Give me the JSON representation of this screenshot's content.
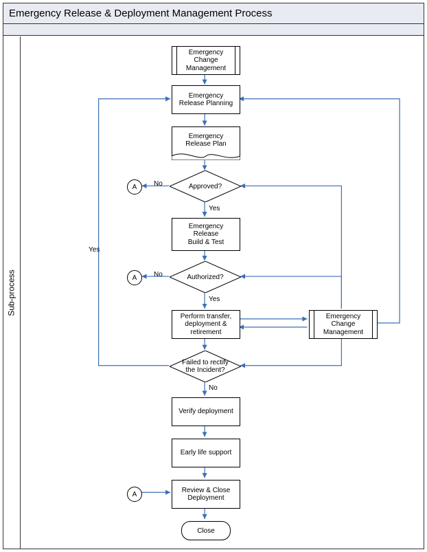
{
  "title": "Emergency Release & Deployment Management Process",
  "swimlane": "Sub-process",
  "nodes": {
    "ecm_top": "Emergency\nChange\nManagement",
    "planning": "Emergency\nRelease Planning",
    "plan_doc": "Emergency\nRelease Plan",
    "approved": "Approved?",
    "build_test": "Emergency\nRelease\nBuild & Test",
    "authorized": "Authorized?",
    "transfer": "Perform transfer,\ndeployment &\nretirement",
    "ecm_right": "Emergency\nChange\nManagement",
    "failed": "Failed to rectify\nthe Incident?",
    "verify": "Verify deployment",
    "els": "Early life support",
    "review": "Review & Close\nDeployment",
    "close": "Close"
  },
  "labels": {
    "yes": "Yes",
    "no": "No"
  },
  "connectors": {
    "a": "A"
  },
  "chart_data": {
    "type": "flowchart",
    "title": "Emergency Release & Deployment Management Process",
    "swimlanes": [
      "Sub-process"
    ],
    "nodes": [
      {
        "id": "ecm_top",
        "type": "subprocess",
        "label": "Emergency Change Management"
      },
      {
        "id": "planning",
        "type": "process",
        "label": "Emergency Release Planning"
      },
      {
        "id": "plan_doc",
        "type": "document",
        "label": "Emergency Release Plan"
      },
      {
        "id": "approved",
        "type": "decision",
        "label": "Approved?"
      },
      {
        "id": "a1",
        "type": "connector",
        "label": "A"
      },
      {
        "id": "build_test",
        "type": "process",
        "label": "Emergency Release Build & Test"
      },
      {
        "id": "authorized",
        "type": "decision",
        "label": "Authorized?"
      },
      {
        "id": "a2",
        "type": "connector",
        "label": "A"
      },
      {
        "id": "transfer",
        "type": "process",
        "label": "Perform transfer, deployment & retirement"
      },
      {
        "id": "ecm_right",
        "type": "subprocess",
        "label": "Emergency Change Management"
      },
      {
        "id": "failed",
        "type": "decision",
        "label": "Failed to rectify the Incident?"
      },
      {
        "id": "verify",
        "type": "process",
        "label": "Verify deployment"
      },
      {
        "id": "els",
        "type": "process",
        "label": "Early life support"
      },
      {
        "id": "review",
        "type": "process",
        "label": "Review & Close Deployment"
      },
      {
        "id": "a3",
        "type": "connector",
        "label": "A"
      },
      {
        "id": "close",
        "type": "terminator",
        "label": "Close"
      }
    ],
    "edges": [
      {
        "from": "ecm_top",
        "to": "planning"
      },
      {
        "from": "planning",
        "to": "plan_doc"
      },
      {
        "from": "plan_doc",
        "to": "approved"
      },
      {
        "from": "approved",
        "to": "a1",
        "label": "No"
      },
      {
        "from": "approved",
        "to": "build_test",
        "label": "Yes"
      },
      {
        "from": "build_test",
        "to": "authorized"
      },
      {
        "from": "authorized",
        "to": "a2",
        "label": "No"
      },
      {
        "from": "authorized",
        "to": "transfer",
        "label": "Yes"
      },
      {
        "from": "transfer",
        "to": "ecm_right",
        "bidirectional": true
      },
      {
        "from": "transfer",
        "to": "failed"
      },
      {
        "from": "failed",
        "to": "planning",
        "label": "Yes"
      },
      {
        "from": "failed",
        "to": "verify",
        "label": "No"
      },
      {
        "from": "verify",
        "to": "els"
      },
      {
        "from": "els",
        "to": "review"
      },
      {
        "from": "a3",
        "to": "review"
      },
      {
        "from": "review",
        "to": "close"
      },
      {
        "from": "ecm_right",
        "to": "planning",
        "note": "loop up right side"
      },
      {
        "from": "ecm_right",
        "to": "approved",
        "note": "feedback"
      },
      {
        "from": "ecm_right",
        "to": "authorized",
        "note": "feedback"
      },
      {
        "from": "ecm_right",
        "to": "failed",
        "note": "feedback"
      }
    ]
  }
}
